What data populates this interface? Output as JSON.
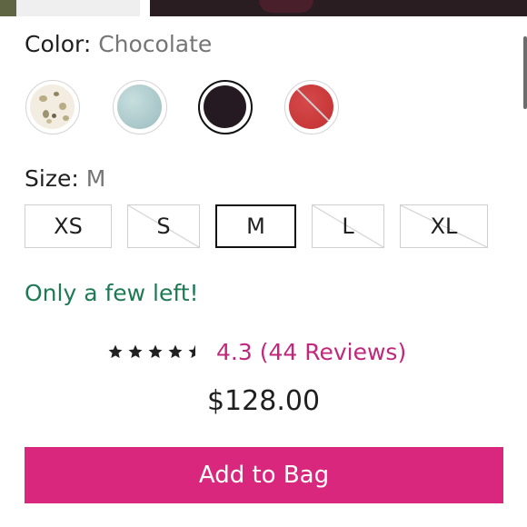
{
  "color": {
    "label": "Color:",
    "selected": "Chocolate",
    "swatches": [
      {
        "name": "floral",
        "available": true,
        "selected": false
      },
      {
        "name": "sky",
        "available": true,
        "selected": false
      },
      {
        "name": "chocolate",
        "available": true,
        "selected": true
      },
      {
        "name": "red",
        "available": false,
        "selected": false
      }
    ]
  },
  "size": {
    "label": "Size:",
    "selected": "M",
    "options": [
      {
        "label": "XS",
        "available": true
      },
      {
        "label": "S",
        "available": false
      },
      {
        "label": "M",
        "available": true,
        "selected": true
      },
      {
        "label": "L",
        "available": false
      },
      {
        "label": "XL",
        "available": false
      }
    ]
  },
  "stock_message": "Only a few left!",
  "rating": {
    "stars": 4.5,
    "text": "4.3 (44 Reviews)"
  },
  "price": "$128.00",
  "add_to_bag_label": "Add to Bag",
  "colors": {
    "accent": "#d8277c",
    "stock_green": "#1e7a55",
    "rating_link": "#c0287b"
  }
}
